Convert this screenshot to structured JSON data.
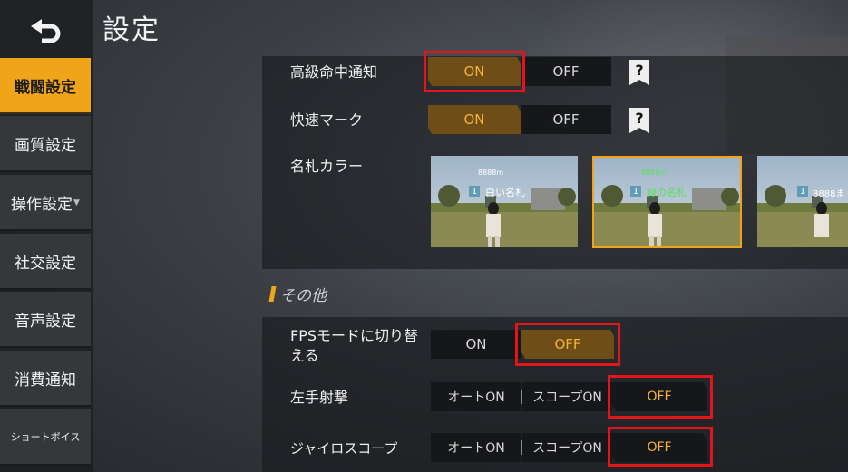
{
  "page": {
    "title": "設定"
  },
  "sidebar": {
    "items": [
      {
        "label": "戦闘設定",
        "active": true
      },
      {
        "label": "画質設定"
      },
      {
        "label": "操作設定",
        "has_submenu": true
      },
      {
        "label": "社交設定"
      },
      {
        "label": "音声設定"
      },
      {
        "label": "消費通知"
      },
      {
        "label": "ショートボイス"
      }
    ]
  },
  "combat": {
    "hit_notice": {
      "label": "高級命中通知",
      "on": "ON",
      "off": "OFF",
      "selected": "ON"
    },
    "quick_mark": {
      "label": "快速マーク",
      "on": "ON",
      "off": "OFF",
      "selected": "ON"
    },
    "nameplate_color": {
      "label": "名札カラー",
      "options": [
        {
          "rank": "1",
          "name": "白い名札",
          "top": "8888m",
          "name_color": "#ffffff"
        },
        {
          "rank": "1",
          "name": "緑の名札",
          "top": "8888m",
          "name_color": "#59e05a",
          "selected": true
        },
        {
          "rank": "1",
          "name": "8888ま",
          "top": "",
          "name_color": "#ffffff"
        }
      ]
    }
  },
  "others": {
    "section_title": "その他",
    "fps_mode": {
      "label": "FPSモードに切り替える",
      "on": "ON",
      "off": "OFF",
      "selected": "OFF"
    },
    "left_fire": {
      "label": "左手射撃",
      "opt1": "オートON",
      "opt2": "スコープON",
      "opt3": "OFF",
      "selected": "OFF"
    },
    "gyroscope": {
      "label": "ジャイロスコープ",
      "opt1": "オートON",
      "opt2": "スコープON",
      "opt3": "OFF",
      "selected": "OFF"
    }
  },
  "colors": {
    "accent": "#f0a419",
    "highlight": "#e3151a",
    "on_fill": "#6e4d16",
    "on_text": "#f4b23a"
  }
}
